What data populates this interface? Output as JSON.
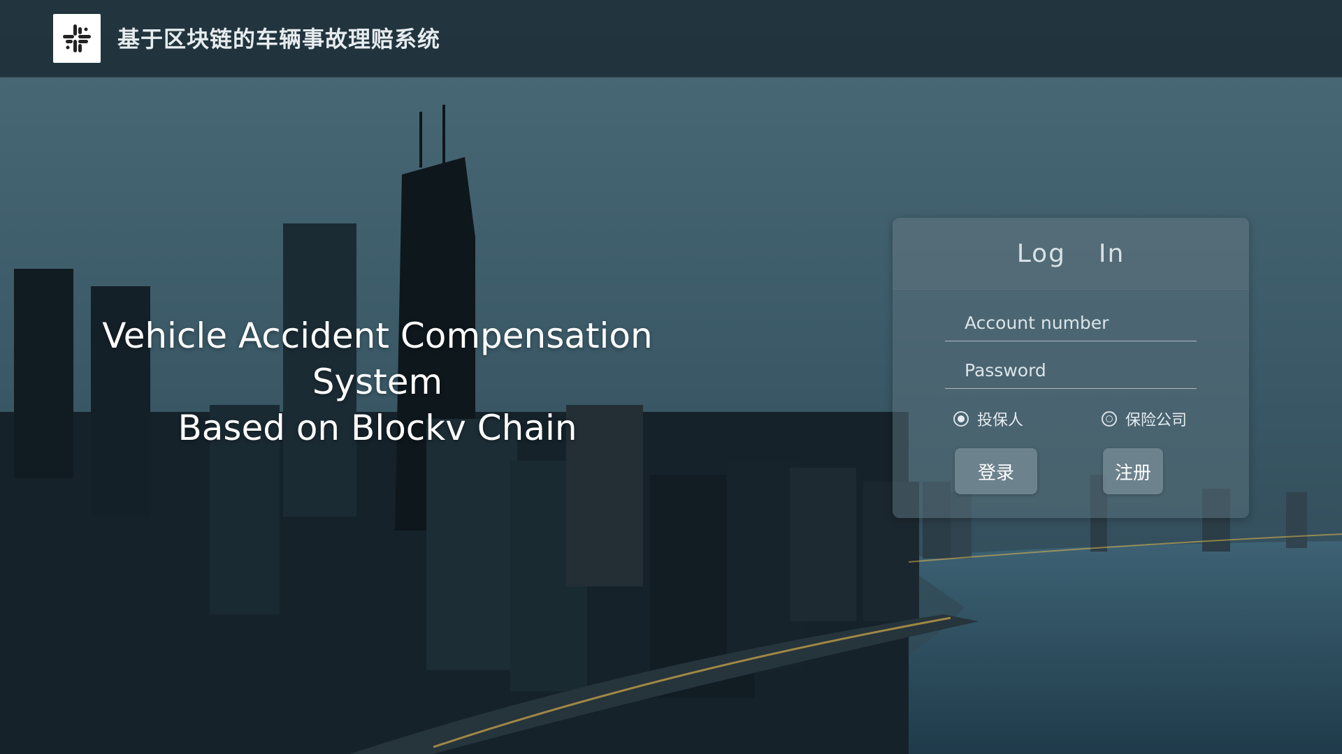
{
  "header": {
    "title": "基于区块链的车辆事故理赔系统",
    "logo_icon": "slack-like-hash-logo"
  },
  "hero": {
    "line1": "Vehicle Accident Compensation System",
    "line2": "Based on Blockv Chain"
  },
  "login": {
    "title": "Log  In",
    "account_placeholder": "Account number",
    "account_value": "",
    "password_placeholder": "Password",
    "password_value": "",
    "roles": [
      {
        "label": "投保人",
        "selected": true
      },
      {
        "label": "保险公司",
        "selected": false
      }
    ],
    "login_button": "登录",
    "register_button": "注册"
  },
  "colors": {
    "header_bg": "#1e3038",
    "card_bg": "#58707a",
    "button_bg": "#788e98",
    "text": "#ffffff"
  }
}
